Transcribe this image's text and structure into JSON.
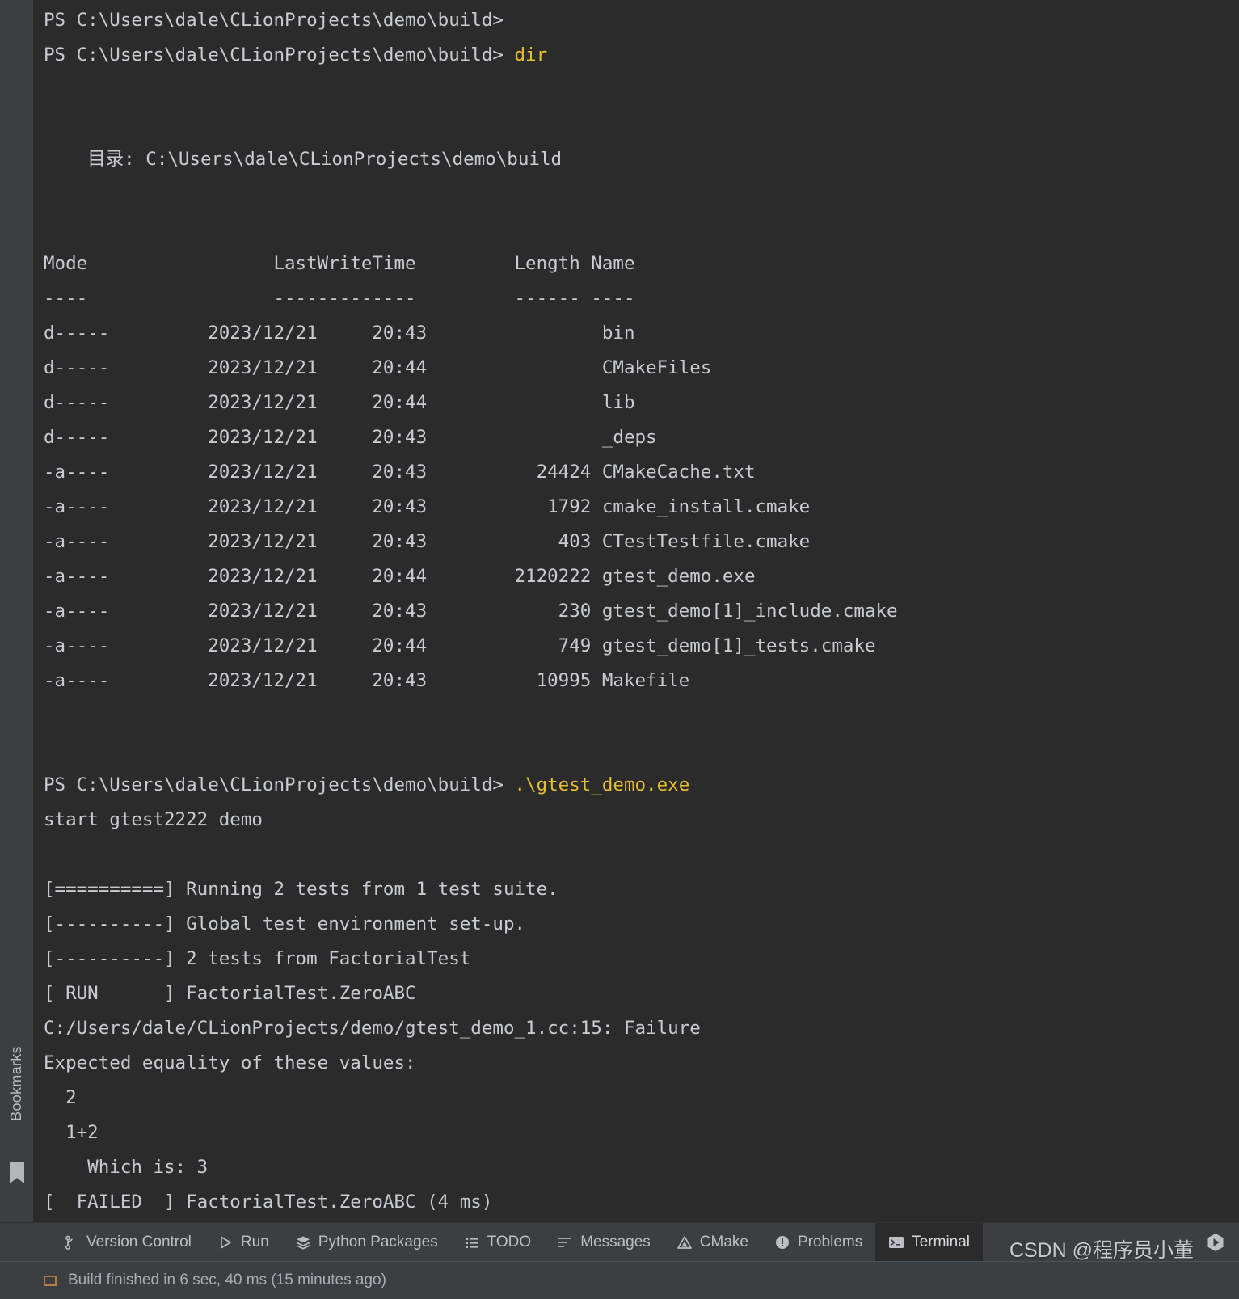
{
  "left_rail": {
    "label": "Bookmarks",
    "icon": "bookmark-flag-icon"
  },
  "terminal": {
    "lines": [
      {
        "type": "prompt",
        "prompt": "PS C:\\Users\\dale\\CLionProjects\\demo\\build>",
        "cmd": ""
      },
      {
        "type": "prompt",
        "prompt": "PS C:\\Users\\dale\\CLionProjects\\demo\\build>",
        "cmd": " dir"
      },
      {
        "type": "blank",
        "text": ""
      },
      {
        "type": "blank",
        "text": ""
      },
      {
        "type": "text",
        "text": "    目录: C:\\Users\\dale\\CLionProjects\\demo\\build"
      },
      {
        "type": "blank",
        "text": ""
      },
      {
        "type": "blank",
        "text": ""
      },
      {
        "type": "text",
        "text": "Mode                 LastWriteTime         Length Name"
      },
      {
        "type": "text",
        "text": "----                 -------------         ------ ----"
      },
      {
        "type": "text",
        "text": "d-----         2023/12/21     20:43                bin"
      },
      {
        "type": "text",
        "text": "d-----         2023/12/21     20:44                CMakeFiles"
      },
      {
        "type": "text",
        "text": "d-----         2023/12/21     20:44                lib"
      },
      {
        "type": "text",
        "text": "d-----         2023/12/21     20:43                _deps"
      },
      {
        "type": "text",
        "text": "-a----         2023/12/21     20:43          24424 CMakeCache.txt"
      },
      {
        "type": "text",
        "text": "-a----         2023/12/21     20:43           1792 cmake_install.cmake"
      },
      {
        "type": "text",
        "text": "-a----         2023/12/21     20:43            403 CTestTestfile.cmake"
      },
      {
        "type": "text",
        "text": "-a----         2023/12/21     20:44        2120222 gtest_demo.exe"
      },
      {
        "type": "text",
        "text": "-a----         2023/12/21     20:43            230 gtest_demo[1]_include.cmake"
      },
      {
        "type": "text",
        "text": "-a----         2023/12/21     20:44            749 gtest_demo[1]_tests.cmake"
      },
      {
        "type": "text",
        "text": "-a----         2023/12/21     20:43          10995 Makefile"
      },
      {
        "type": "blank",
        "text": ""
      },
      {
        "type": "blank",
        "text": ""
      },
      {
        "type": "prompt",
        "prompt": "PS C:\\Users\\dale\\CLionProjects\\demo\\build>",
        "cmd": " .\\gtest_demo.exe"
      },
      {
        "type": "text",
        "text": "start gtest2222 demo"
      },
      {
        "type": "blank",
        "text": ""
      },
      {
        "type": "text",
        "text": "[==========] Running 2 tests from 1 test suite."
      },
      {
        "type": "text",
        "text": "[----------] Global test environment set-up."
      },
      {
        "type": "text",
        "text": "[----------] 2 tests from FactorialTest"
      },
      {
        "type": "text",
        "text": "[ RUN      ] FactorialTest.ZeroABC"
      },
      {
        "type": "text",
        "text": "C:/Users/dale/CLionProjects/demo/gtest_demo_1.cc:15: Failure"
      },
      {
        "type": "text",
        "text": "Expected equality of these values:"
      },
      {
        "type": "text",
        "text": "  2"
      },
      {
        "type": "text",
        "text": "  1+2"
      },
      {
        "type": "text",
        "text": "    Which is: 3"
      },
      {
        "type": "text",
        "text": "[  FAILED  ] FactorialTest.ZeroABC (4 ms)"
      }
    ]
  },
  "toolbar": {
    "items": [
      {
        "label": "Version Control",
        "icon": "branch-icon",
        "active": false
      },
      {
        "label": "Run",
        "icon": "play-icon",
        "active": false
      },
      {
        "label": "Python Packages",
        "icon": "layers-icon",
        "active": false
      },
      {
        "label": "TODO",
        "icon": "list-icon",
        "active": false
      },
      {
        "label": "Messages",
        "icon": "messages-icon",
        "active": false
      },
      {
        "label": "CMake",
        "icon": "cmake-triangle-icon",
        "active": false
      },
      {
        "label": "Problems",
        "icon": "warning-circle-icon",
        "active": false
      },
      {
        "label": "Terminal",
        "icon": "terminal-icon",
        "active": true
      }
    ],
    "right_items": [
      {
        "label": "",
        "icon": "services-play-icon"
      }
    ]
  },
  "statusbar": {
    "icon": "build-icon",
    "text": "Build finished in 6 sec, 40 ms (15 minutes ago)"
  },
  "watermark": {
    "text": "CSDN @程序员小董"
  },
  "colors": {
    "terminal_bg": "#2b2b2b",
    "terminal_fg": "#c8ccd0",
    "command_yellow": "#e8bf2e",
    "panel_bg": "#3c3f41",
    "rail_bg": "#3c3f41"
  }
}
